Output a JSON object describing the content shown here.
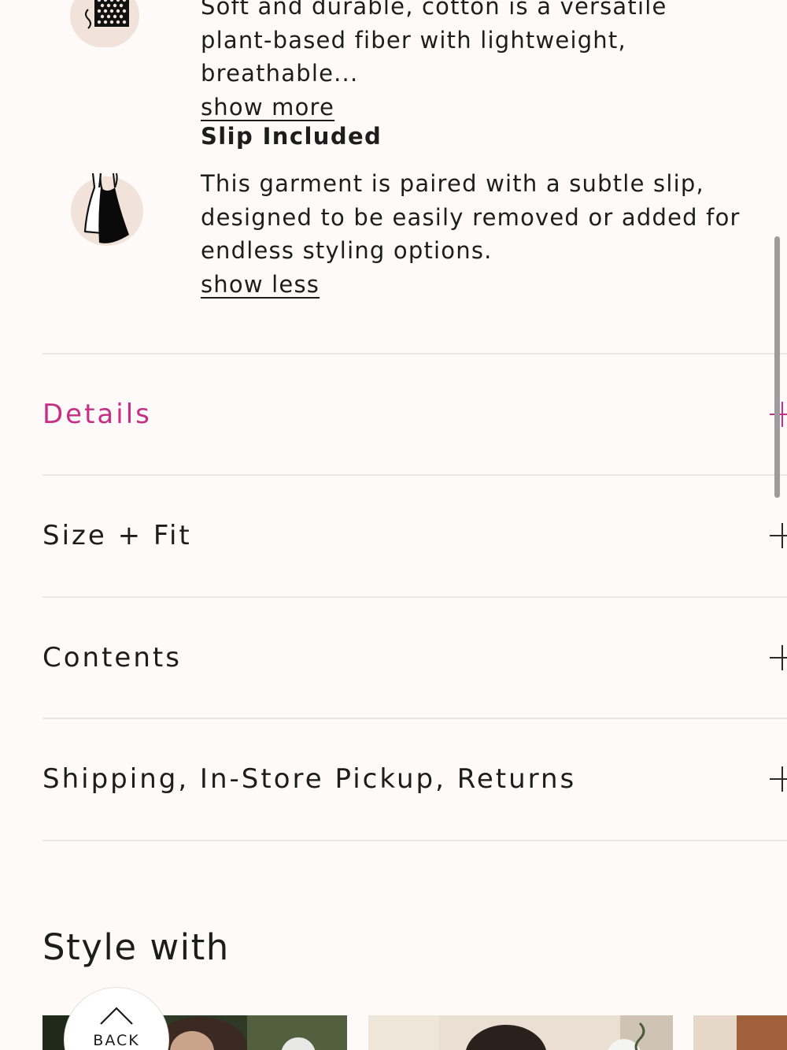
{
  "features": {
    "cotton": {
      "description": "Soft and durable, cotton is a versatile plant-based fiber with lightweight, breathable...",
      "toggle": "show more",
      "icon": "fabric-swatch-icon"
    },
    "slip": {
      "title": "Slip Included",
      "description": "This garment is paired with a subtle slip, designed to be easily removed or added for endless styling options.",
      "toggle": "show less",
      "icon": "slip-dress-icon"
    }
  },
  "accordion": {
    "details": "Details",
    "size_fit": "Size + Fit",
    "contents": "Contents",
    "shipping": "Shipping, In-Store Pickup, Returns"
  },
  "style_with": {
    "heading": "Style with"
  },
  "back_button": {
    "label": "BACK",
    "icon": "chevron-up-icon"
  },
  "colors": {
    "accent": "#c62f84",
    "background": "#fdfaf9",
    "icon_blob": "#f1e2da",
    "text": "#1d1d1d"
  }
}
